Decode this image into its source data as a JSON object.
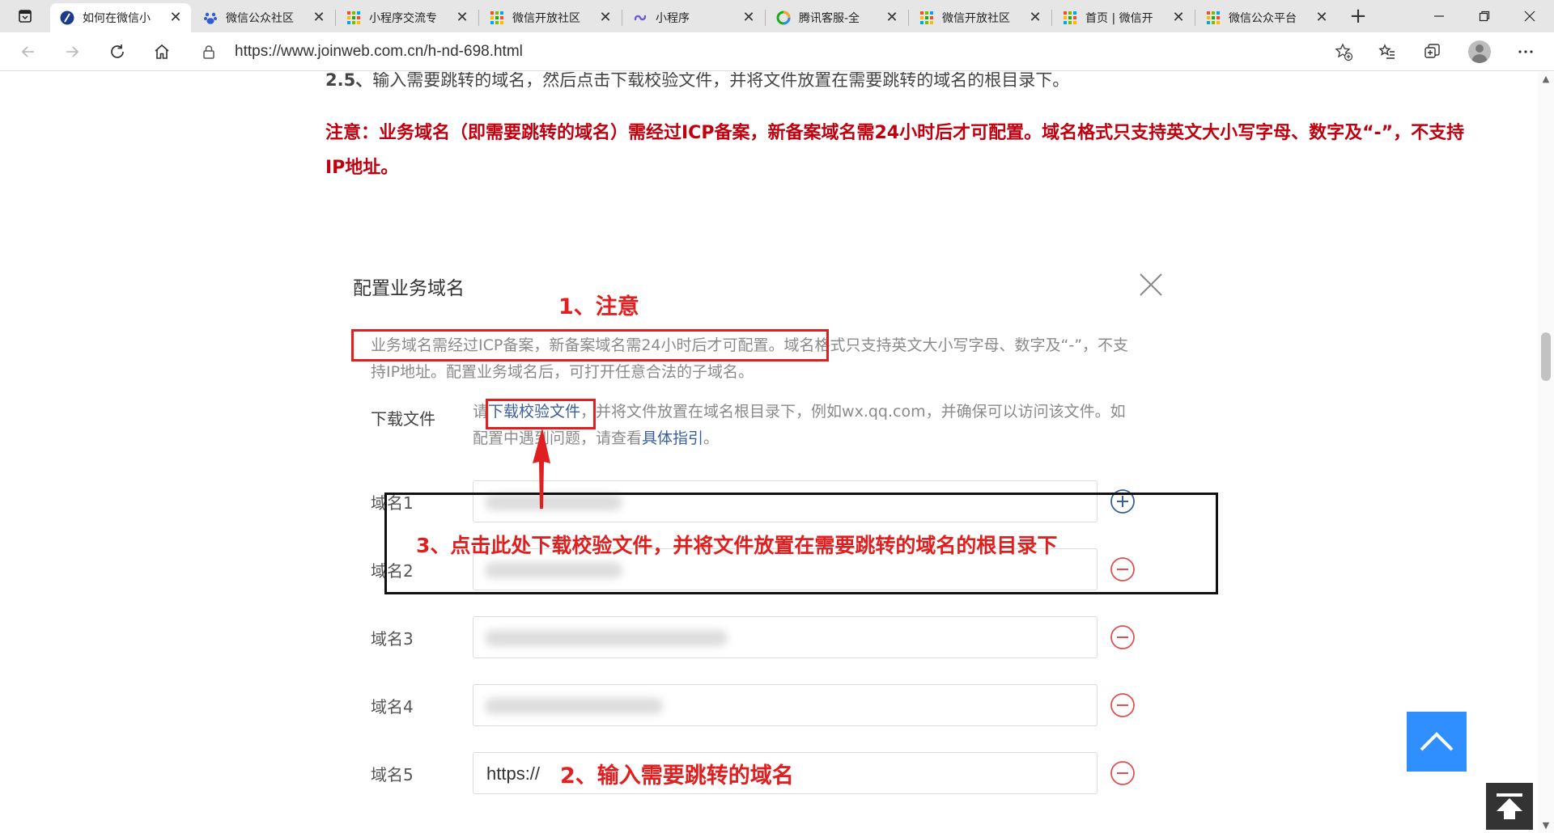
{
  "browser": {
    "tabs": [
      {
        "title": "如何在微信小",
        "icon": "feather-icon",
        "active": true
      },
      {
        "title": "微信公众社区",
        "icon": "paw-icon",
        "active": false
      },
      {
        "title": "小程序交流专",
        "icon": "wechat-grid-icon",
        "active": false
      },
      {
        "title": "微信开放社区",
        "icon": "wechat-grid-icon",
        "active": false
      },
      {
        "title": "小程序",
        "icon": "miniprogram-icon",
        "active": false
      },
      {
        "title": "腾讯客服-全",
        "icon": "tencent-ring-icon",
        "active": false
      },
      {
        "title": "微信开放社区",
        "icon": "wechat-grid-icon",
        "active": false
      },
      {
        "title": "首页 | 微信开",
        "icon": "wechat-grid-icon",
        "active": false
      },
      {
        "title": "微信公众平台",
        "icon": "wechat-grid-icon",
        "active": false
      }
    ],
    "close_glyph": "✕",
    "newtab_glyph": "+",
    "url": "https://www.joinweb.com.cn/h-nd-698.html"
  },
  "article": {
    "step_number": "2.5、",
    "step_text": "输入需要跳转的域名，然后点击下载校验文件，并将文件放置在需要跳转的域名的根目录下。",
    "note": "注意：业务域名（即需要跳转的域名）需经过ICP备案，新备案域名需24小时后才可配置。域名格式只支持英文大小写字母、数字及“-”，不支持IP地址。"
  },
  "dialog": {
    "title": "配置业务域名",
    "desc": "业务域名需经过ICP备案，新备案域名需24小时后才可配置。域名格式只支持英文大小写字母、数字及“-”，不支持IP地址。配置业务域名后，可打开任意合法的子域名。",
    "download_label": "下载文件",
    "download_pre": "请",
    "download_link": "下载校验文件",
    "download_mid": "，并将文件放置在域名根目录下，例如wx.qq.com，并确保可以访问该文件。如配置中遇到问题，请查看",
    "guide_link": "具体指引",
    "guide_end": "。",
    "domains": [
      {
        "label": "域名1",
        "value": "",
        "action": "plus"
      },
      {
        "label": "域名2",
        "value": "",
        "action": "minus"
      },
      {
        "label": "域名3",
        "value": "",
        "action": "minus"
      },
      {
        "label": "域名4",
        "value": "",
        "action": "minus"
      },
      {
        "label": "域名5",
        "value": "https://",
        "action": "minus"
      }
    ]
  },
  "annotations": {
    "a1": "1、注意",
    "a2": "2、输入需要跳转的域名",
    "a3": "3、点击此处下载校验文件，并将文件放置在需要跳转的域名的根目录下"
  },
  "colors": {
    "accent_red": "#e02020",
    "note_red": "#c0000f",
    "link_blue": "#3a5f9e",
    "totop_blue": "#2f8fff"
  }
}
